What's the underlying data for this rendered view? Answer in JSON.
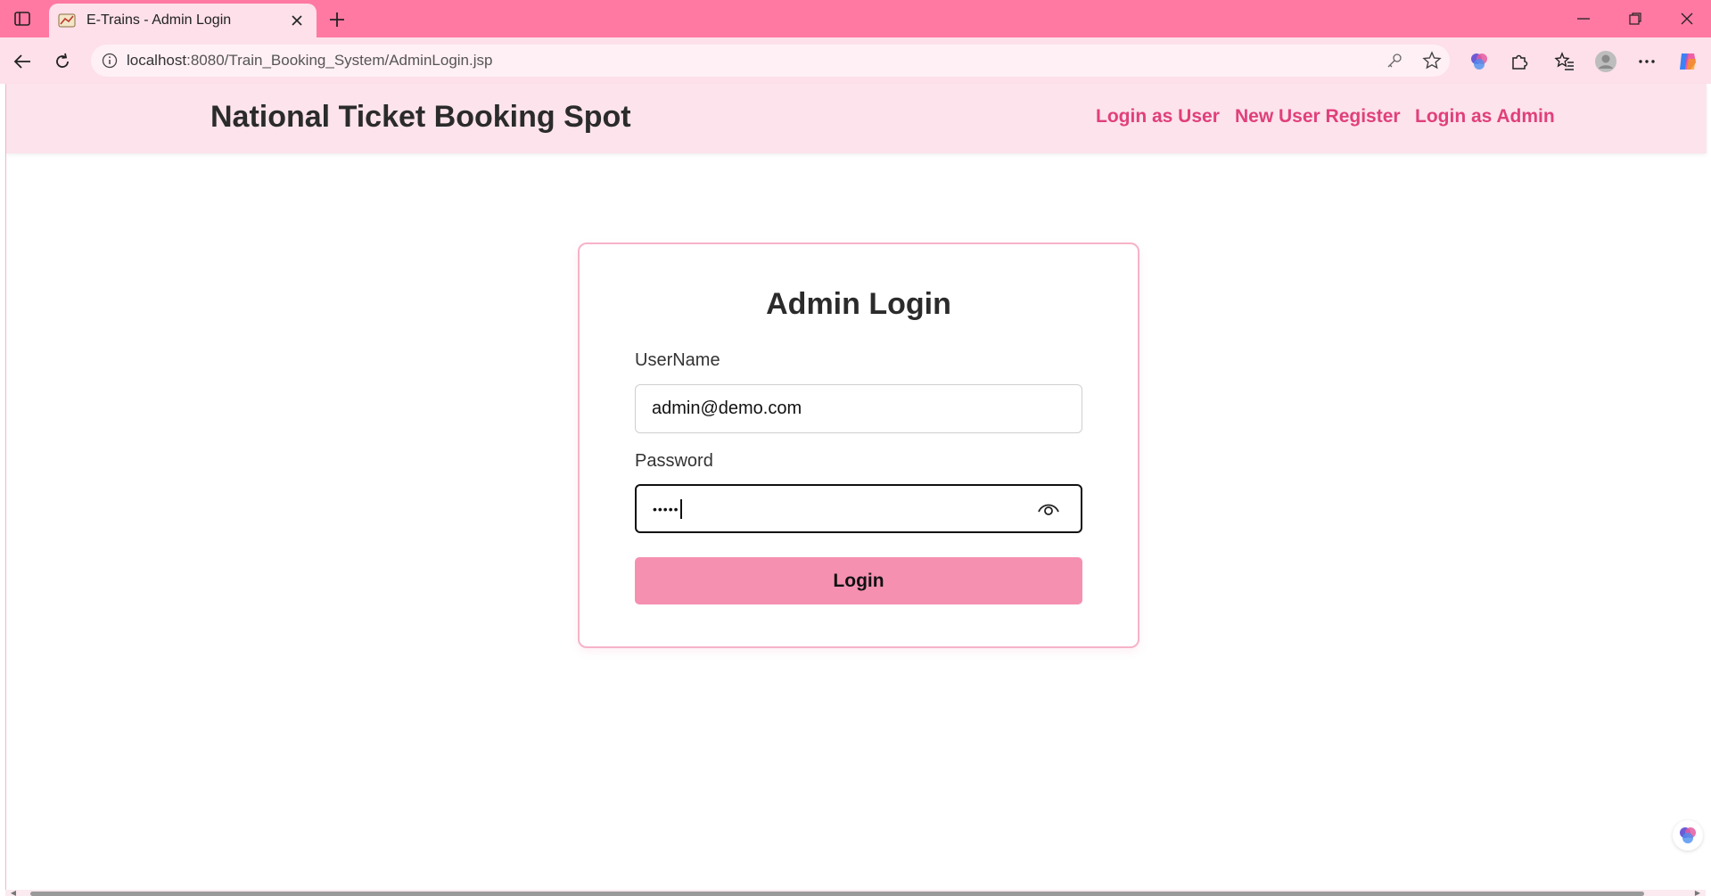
{
  "browser": {
    "tab_title": "E-Trains - Admin Login",
    "url_host": "localhost",
    "url_path": ":8080/Train_Booking_System/AdminLogin.jsp"
  },
  "header": {
    "brand": "National Ticket Booking Spot",
    "nav": {
      "login_user": "Login as User",
      "register": "New User Register",
      "login_admin": "Login as Admin"
    }
  },
  "login_form": {
    "title": "Admin Login",
    "username_label": "UserName",
    "username_value": "admin@demo.com",
    "password_label": "Password",
    "password_masked": "•••••",
    "submit_label": "Login"
  },
  "colors": {
    "tabbar": "#ff79a3",
    "header_bg": "#fde3ec",
    "nav_link": "#e0407a",
    "button": "#f590b1",
    "card_border": "#f6b3c8"
  }
}
